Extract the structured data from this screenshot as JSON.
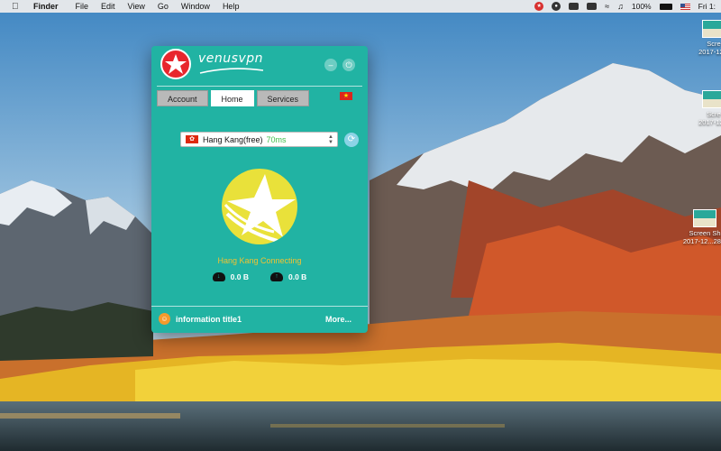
{
  "menubar": {
    "app_name": "Finder",
    "items": [
      "File",
      "Edit",
      "View",
      "Go",
      "Window",
      "Help"
    ],
    "battery": "100%",
    "clock": "Fri 1:"
  },
  "desktop_icons": [
    {
      "label_line1": "Scre",
      "label_line2": "2017-12..."
    },
    {
      "label_line1": "Scre",
      "label_line2": "2017-12..."
    },
    {
      "label_line1": "Screen Sh",
      "label_line2": "2017-12...28..."
    }
  ],
  "vpn_app": {
    "logo_text": "venusvpn",
    "tabs": [
      {
        "label": "Account"
      },
      {
        "label": "Home"
      },
      {
        "label": "Services"
      }
    ],
    "server": {
      "name": "Hang Kang(free)",
      "ping": "70ms"
    },
    "status_text": "Hang Kang Connecting",
    "download": "0.0 B",
    "upload": "0.0 B",
    "info_title": "information title1",
    "more_label": "More..."
  },
  "colors": {
    "app_bg": "#21b3a3",
    "logo_red": "#e8262d",
    "connect_yellow": "#e9e13a",
    "status_orange": "#f1c232",
    "ping_green": "#3fbf4a"
  }
}
